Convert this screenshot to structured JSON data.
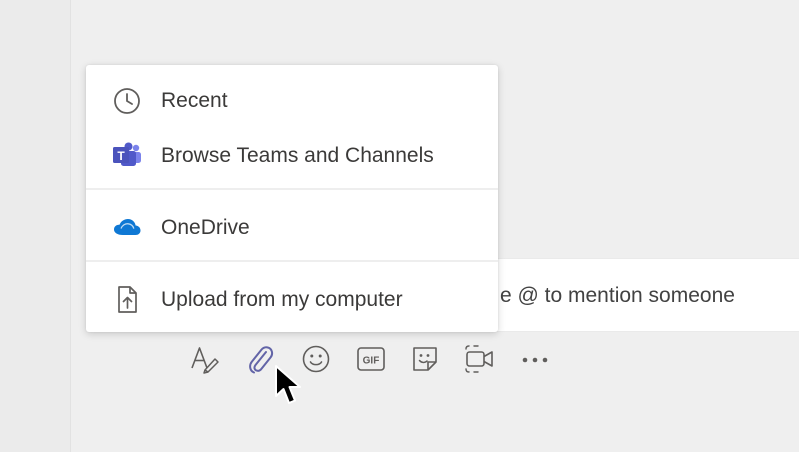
{
  "attach_menu": {
    "items": [
      {
        "label": "Recent",
        "icon": "clock-icon"
      },
      {
        "label": "Browse Teams and Channels",
        "icon": "teams-icon"
      },
      {
        "label": "OneDrive",
        "icon": "onedrive-cloud-icon"
      },
      {
        "label": "Upload from my computer",
        "icon": "upload-file-icon"
      }
    ]
  },
  "compose": {
    "placeholder_visible": "e @ to mention someone"
  },
  "toolbar": {
    "buttons": [
      {
        "name": "format",
        "icon": "format-icon"
      },
      {
        "name": "attach",
        "icon": "paperclip-icon",
        "active": true
      },
      {
        "name": "emoji",
        "icon": "emoji-icon"
      },
      {
        "name": "gif",
        "icon": "gif-icon",
        "label": "GIF"
      },
      {
        "name": "sticker",
        "icon": "sticker-icon"
      },
      {
        "name": "meet-now",
        "icon": "video-icon"
      },
      {
        "name": "more",
        "icon": "more-options-icon"
      }
    ]
  },
  "colors": {
    "teams_purple": "#6264a7",
    "onedrive_blue": "#0f78d4",
    "icon_gray": "#605e5c",
    "background": "#efefef"
  }
}
